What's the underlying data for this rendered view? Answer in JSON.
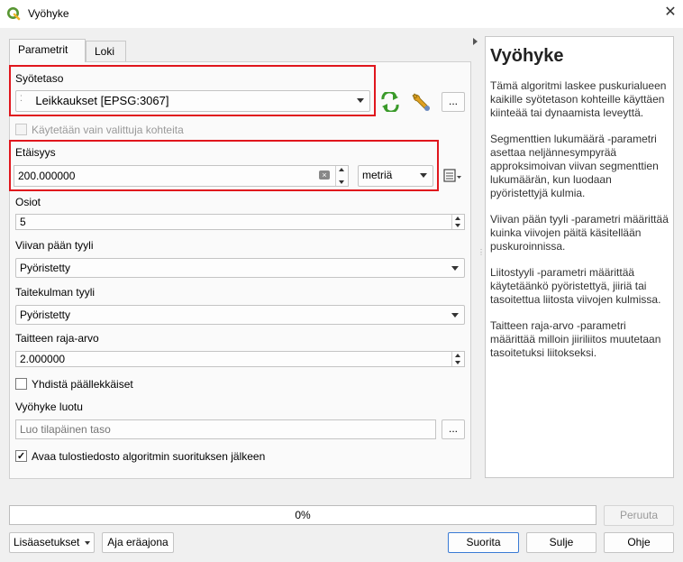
{
  "window": {
    "title": "Vyöhyke",
    "close_glyph": "✕"
  },
  "tabs": [
    {
      "label": "Parametrit",
      "active": true
    },
    {
      "label": "Loki",
      "active": false
    }
  ],
  "params": {
    "input_layer": {
      "label": "Syötetaso",
      "value": "Leikkaukset [EPSG:3067]",
      "icon": "point-layer-icon"
    },
    "selected_only": {
      "label": "Käytetään vain valittuja kohteita",
      "checked": false,
      "enabled": false
    },
    "distance": {
      "label": "Etäisyys",
      "value": "200.000000",
      "unit": "metriä"
    },
    "segments": {
      "label": "Osiot",
      "value": "5"
    },
    "end_cap": {
      "label": "Viivan pään tyyli",
      "value": "Pyöristetty"
    },
    "join_style": {
      "label": "Taitekulman tyyli",
      "value": "Pyöristetty"
    },
    "miter_limit": {
      "label": "Taitteen raja-arvo",
      "value": "2.000000"
    },
    "dissolve": {
      "label": "Yhdistä päällekkäiset",
      "checked": false
    },
    "output": {
      "label": "Vyöhyke luotu",
      "placeholder": "Luo tilapäinen taso"
    },
    "open_output": {
      "label": "Avaa tulostiedosto algoritmin suorituksen jälkeen",
      "checked": true
    },
    "browse_label": "...",
    "checkmark": "✓"
  },
  "help": {
    "title": "Vyöhyke",
    "paragraphs": [
      "Tämä algoritmi laskee puskurialueen kaikille syötetason kohteille käyttäen kiinteää tai dynaamista leveyttä.",
      "Segmenttien lukumäärä -parametri asettaa neljännesympyrää approksimoivan viivan segmenttien lukumäärän, kun luodaan pyöristettyjä kulmia.",
      "Viivan pään tyyli -parametri määrittää kuinka viivojen päitä käsitellään puskuroinnissa.",
      "Liitostyyli -parametri määrittää käytetäänkö pyöristettyä, jiiriä tai tasoitettua liitosta viivojen kulmissa.",
      "Taitteen raja-arvo -parametri määrittää milloin jiiriliitos muutetaan tasoitetuksi liitokseksi."
    ]
  },
  "progress": {
    "percent": 0,
    "text": "0%"
  },
  "buttons": {
    "cancel": "Peruuta",
    "advanced": "Lisäasetukset",
    "batch": "Aja eräajona",
    "run": "Suorita",
    "close": "Sulje",
    "help": "Ohje"
  },
  "colors": {
    "highlight_red": "#e0161d",
    "qgis_green": "#589632",
    "run_border": "#3a7bd5"
  }
}
